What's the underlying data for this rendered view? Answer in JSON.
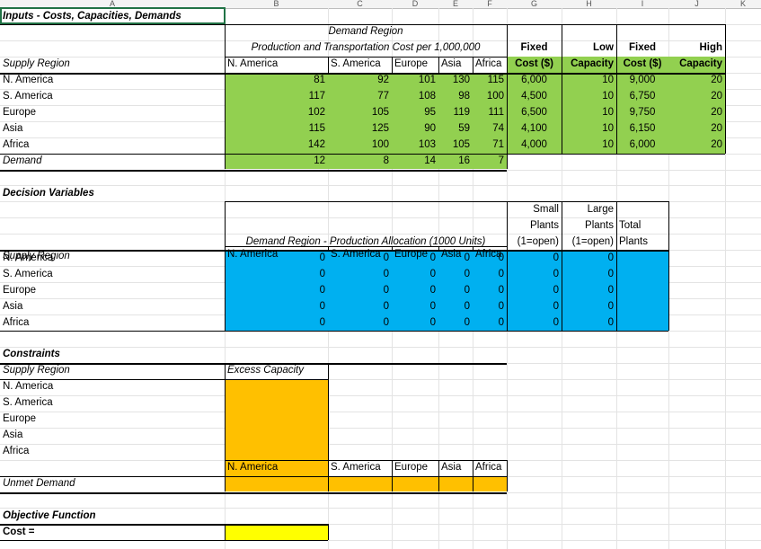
{
  "column_headers": [
    "A",
    "B",
    "C",
    "D",
    "E",
    "F",
    "G",
    "H",
    "I",
    "J",
    "K"
  ],
  "inputs": {
    "title": "Inputs - Costs, Capacities, Demands",
    "demand_region_label": "Demand Region",
    "cost_caption": "Production and Transportation Cost per 1,000,000",
    "supply_region_label": "Supply Region",
    "regions": [
      "N. America",
      "S. America",
      "Europe",
      "Asia",
      "Africa"
    ],
    "fixed_cost_low_top": "Fixed",
    "fixed_cost_low_bottom": "Cost ($)",
    "low_capacity_top": "Low",
    "low_capacity_bottom": "Capacity",
    "fixed_cost_high_top": "Fixed",
    "fixed_cost_high_bottom": "Cost ($)",
    "high_capacity_top": "High",
    "high_capacity_bottom": "Capacity",
    "cost_rows": [
      {
        "region": "N. America",
        "costs": [
          "81",
          "92",
          "101",
          "130",
          "115"
        ],
        "fixed_low": "6,000",
        "low_cap": "10",
        "fixed_high": "9,000",
        "high_cap": "20"
      },
      {
        "region": "S. America",
        "costs": [
          "117",
          "77",
          "108",
          "98",
          "100"
        ],
        "fixed_low": "4,500",
        "low_cap": "10",
        "fixed_high": "6,750",
        "high_cap": "20"
      },
      {
        "region": "Europe",
        "costs": [
          "102",
          "105",
          "95",
          "119",
          "111"
        ],
        "fixed_low": "6,500",
        "low_cap": "10",
        "fixed_high": "9,750",
        "high_cap": "20"
      },
      {
        "region": "Asia",
        "costs": [
          "115",
          "125",
          "90",
          "59",
          "74"
        ],
        "fixed_low": "4,100",
        "low_cap": "10",
        "fixed_high": "6,150",
        "high_cap": "20"
      },
      {
        "region": "Africa",
        "costs": [
          "142",
          "100",
          "103",
          "105",
          "71"
        ],
        "fixed_low": "4,000",
        "low_cap": "10",
        "fixed_high": "6,000",
        "high_cap": "20"
      }
    ],
    "demand_label": "Demand",
    "demand_values": [
      "12",
      "8",
      "14",
      "16",
      "7"
    ]
  },
  "decision": {
    "title": "Decision Variables",
    "allocation_caption": "Demand Region - Production Allocation (1000 Units)",
    "supply_region_label": "Supply Region",
    "small_plants_top": "Small",
    "small_plants_mid": "Plants",
    "small_plants_bottom": "(1=open)",
    "large_plants_top": "Large",
    "large_plants_mid": "Plants",
    "large_plants_bottom": "(1=open)",
    "total_plants_top": "Total",
    "total_plants_bottom": "Plants",
    "rows": [
      {
        "values": [
          "0",
          "0",
          "0",
          "0",
          "0"
        ],
        "small": "0",
        "large": "0"
      },
      {
        "values": [
          "0",
          "0",
          "0",
          "0",
          "0"
        ],
        "small": "0",
        "large": "0"
      },
      {
        "values": [
          "0",
          "0",
          "0",
          "0",
          "0"
        ],
        "small": "0",
        "large": "0"
      },
      {
        "values": [
          "0",
          "0",
          "0",
          "0",
          "0"
        ],
        "small": "0",
        "large": "0"
      },
      {
        "values": [
          "0",
          "0",
          "0",
          "0",
          "0"
        ],
        "small": "0",
        "large": "0"
      }
    ]
  },
  "constraints": {
    "title": "Constraints",
    "supply_region_label": "Supply Region",
    "excess_capacity_label": "Excess Capacity",
    "unmet_demand_label": "Unmet Demand"
  },
  "objective": {
    "title": "Objective Function",
    "cost_label": "Cost ="
  },
  "colors": {
    "input_fill": "#92d050",
    "decision_fill": "#00b0f0",
    "constraint_fill": "#ffc000",
    "objective_fill": "#ffff00",
    "selection_border": "#217346"
  }
}
